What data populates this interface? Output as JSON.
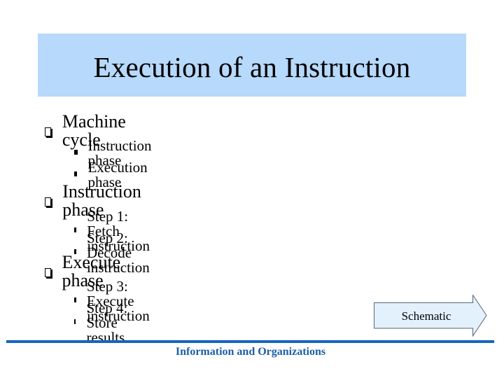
{
  "slide": {
    "title": "Execution of an Instruction",
    "sections": [
      {
        "heading": "Machine cycle",
        "bullets": [
          "Instruction phase",
          "Execution phase"
        ]
      },
      {
        "heading": "Instruction phase",
        "bullets": [
          "Step 1: Fetch instruction",
          "Step 2: Decode instruction"
        ]
      },
      {
        "heading": "Execute phase",
        "bullets": [
          "Step 3: Execute instruction",
          "Step 4: Store results"
        ]
      }
    ],
    "arrow_button": {
      "label": "Schematic",
      "icon": "right-arrow-icon"
    },
    "footer": "Information and Organizations"
  },
  "colors": {
    "title_background": "#b7d9fb",
    "arrow_fill": "#e3f1fd",
    "footer_accent": "#1565c0",
    "footer_text": "#1b5fa8"
  }
}
